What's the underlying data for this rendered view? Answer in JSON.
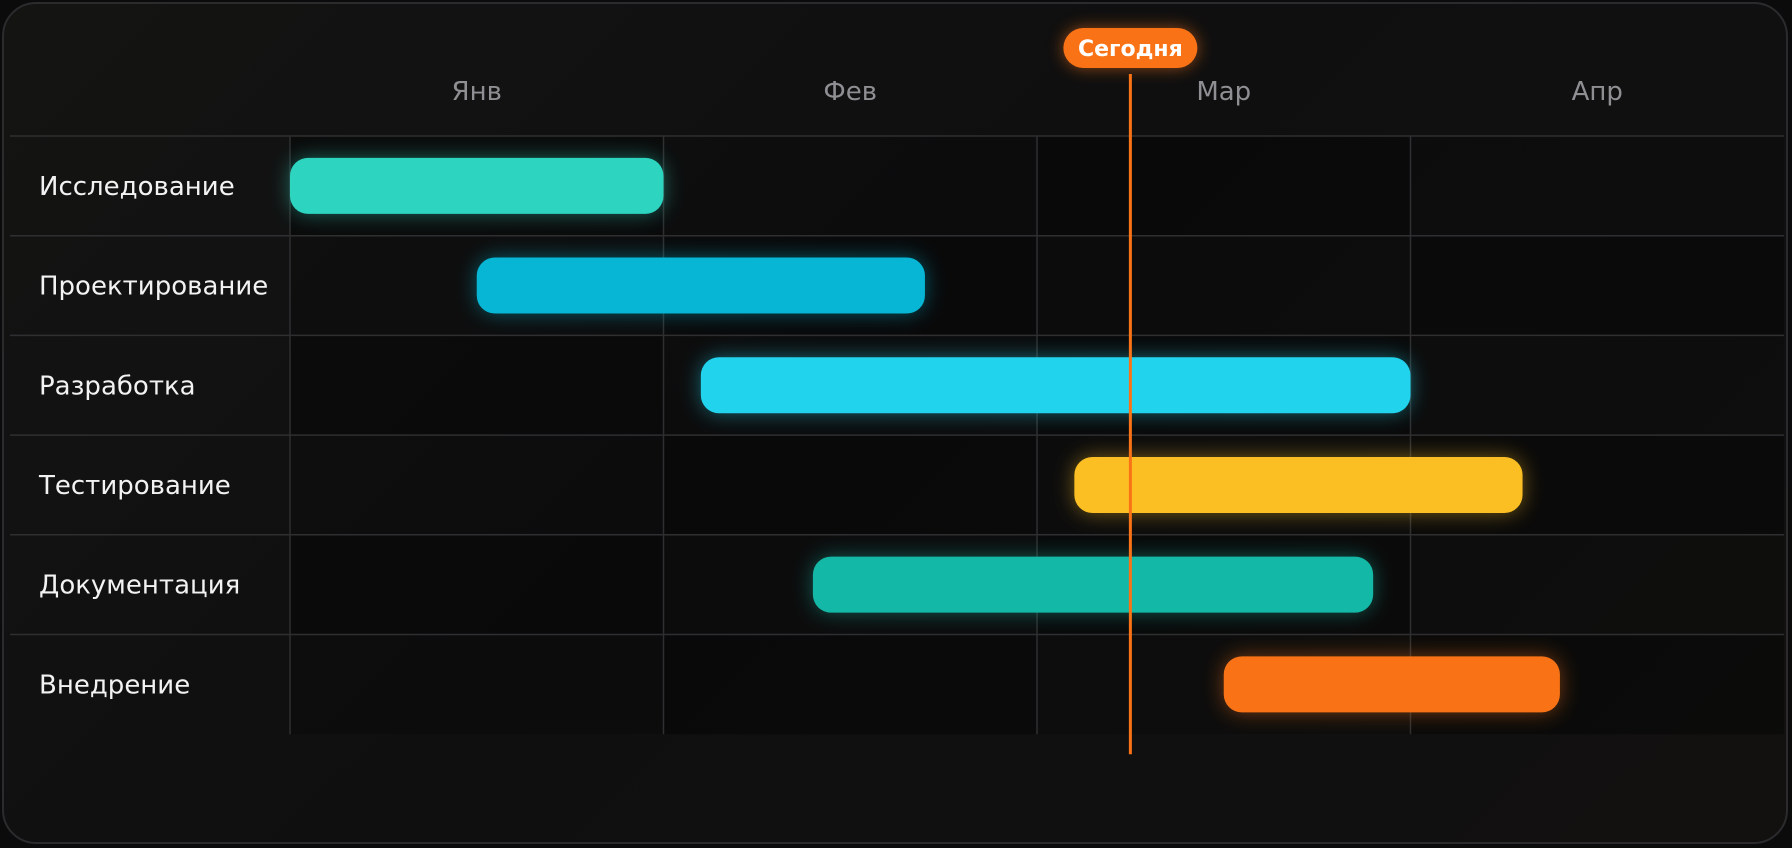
{
  "chart_data": {
    "type": "gantt",
    "months": [
      "Янв",
      "Фев",
      "Мар",
      "Апр"
    ],
    "today_label": "Сегодня",
    "today": 2.25,
    "tasks": [
      {
        "name": "Исследование",
        "start": 0.0,
        "end": 1.0,
        "color": "#2dd4bf"
      },
      {
        "name": "Проектирование",
        "start": 0.5,
        "end": 1.7,
        "color": "#06b6d4"
      },
      {
        "name": "Разработка",
        "start": 1.1,
        "end": 3.0,
        "color": "#22d3ee"
      },
      {
        "name": "Тестирование",
        "start": 2.1,
        "end": 3.3,
        "color": "#fbbf24"
      },
      {
        "name": "Документация",
        "start": 1.4,
        "end": 2.9,
        "color": "#14b8a6"
      },
      {
        "name": "Внедрение",
        "start": 2.5,
        "end": 3.4,
        "color": "#f97316"
      }
    ],
    "grid": true
  },
  "colors": {
    "today": "#f97316",
    "grid": "#2f2f31"
  }
}
